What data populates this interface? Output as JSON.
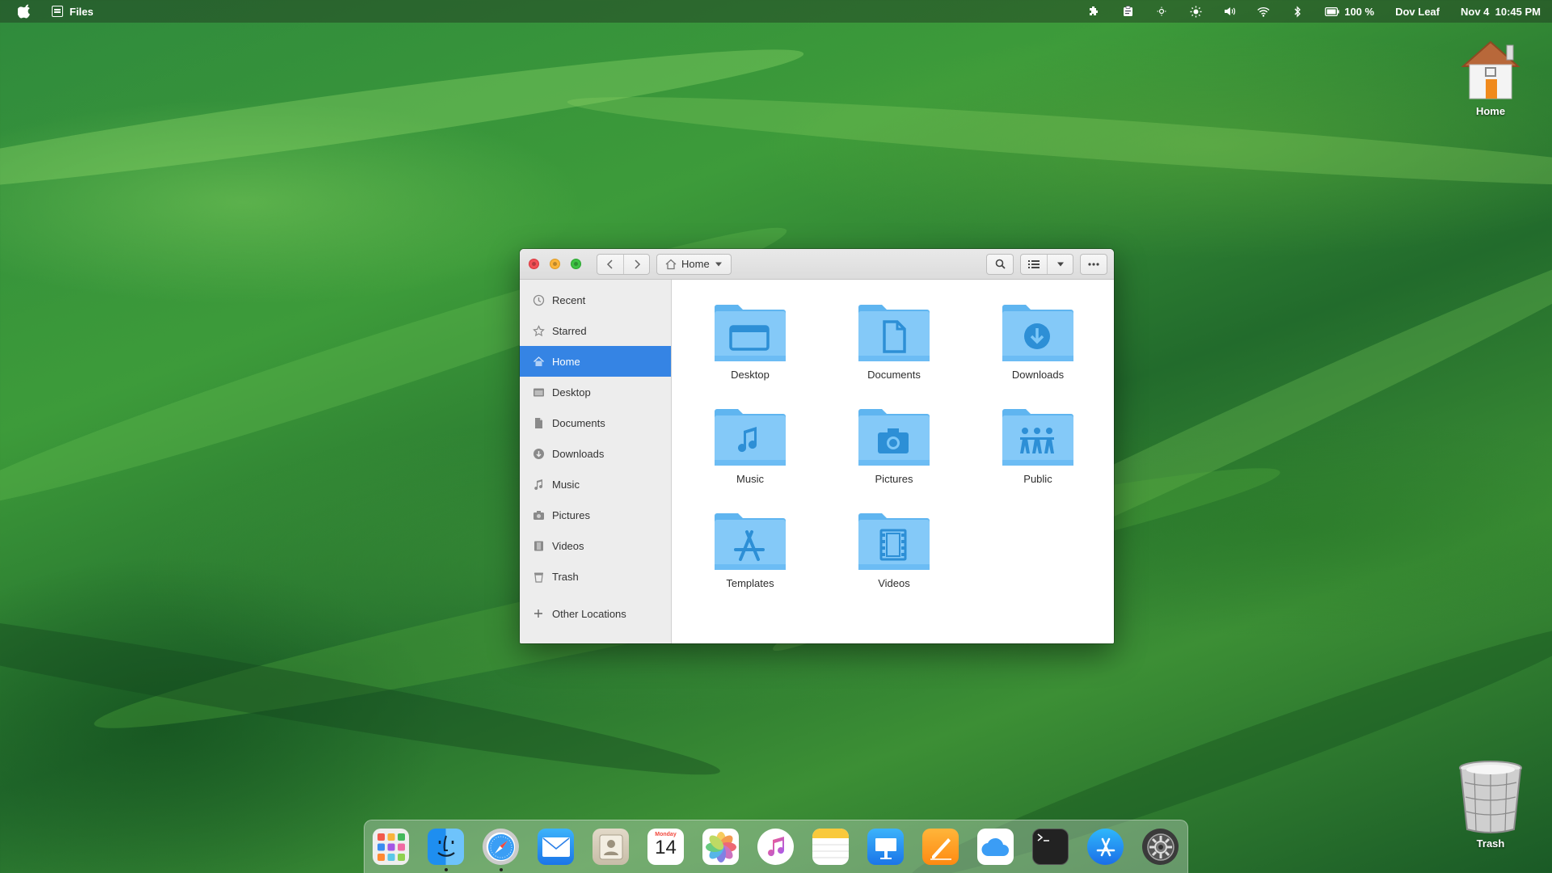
{
  "topbar": {
    "app_name": "Files",
    "battery": "100 %",
    "user": "Dov Leaf",
    "datetime": "Nov 4  10:45 PM",
    "icons": [
      "extensions-icon",
      "clipboard-icon",
      "night-light-icon",
      "brightness-icon",
      "volume-icon",
      "wifi-icon",
      "bluetooth-icon",
      "battery-icon"
    ]
  },
  "desktop": {
    "home_label": "Home",
    "trash_label": "Trash"
  },
  "window": {
    "path_label": "Home",
    "sidebar": {
      "items": [
        {
          "label": "Recent",
          "icon": "clock-icon"
        },
        {
          "label": "Starred",
          "icon": "star-icon"
        },
        {
          "label": "Home",
          "icon": "home-icon",
          "active": true
        },
        {
          "label": "Desktop",
          "icon": "desktop-icon"
        },
        {
          "label": "Documents",
          "icon": "document-icon"
        },
        {
          "label": "Downloads",
          "icon": "download-icon"
        },
        {
          "label": "Music",
          "icon": "music-icon"
        },
        {
          "label": "Pictures",
          "icon": "camera-icon"
        },
        {
          "label": "Videos",
          "icon": "film-icon"
        },
        {
          "label": "Trash",
          "icon": "trash-icon"
        }
      ],
      "other_locations": "Other Locations"
    },
    "folders": [
      {
        "label": "Desktop",
        "glyph": "desktop"
      },
      {
        "label": "Documents",
        "glyph": "document"
      },
      {
        "label": "Downloads",
        "glyph": "download"
      },
      {
        "label": "Music",
        "glyph": "music"
      },
      {
        "label": "Pictures",
        "glyph": "camera"
      },
      {
        "label": "Public",
        "glyph": "people"
      },
      {
        "label": "Templates",
        "glyph": "templates"
      },
      {
        "label": "Videos",
        "glyph": "film"
      }
    ]
  },
  "dock": {
    "calendar_day": "Monday",
    "calendar_date": "14",
    "apps": [
      "launchpad",
      "files",
      "safari",
      "mail",
      "contacts",
      "calendar",
      "photos",
      "music",
      "notes",
      "keynote",
      "pages",
      "icloud",
      "terminal",
      "app-store",
      "settings"
    ]
  }
}
